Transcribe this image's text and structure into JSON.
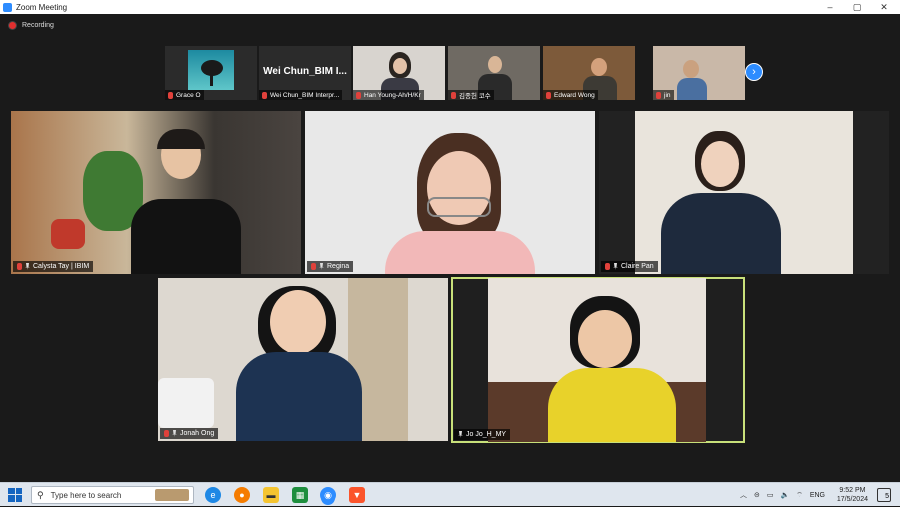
{
  "window": {
    "title": "Zoom Meeting",
    "controls": {
      "minimize": "–",
      "maximize": "▢",
      "close": "✕"
    }
  },
  "recording": {
    "label": "Recording"
  },
  "thumbnails": [
    {
      "name": "Grace O",
      "muted": true
    },
    {
      "name": "Wei Chun_BIM Interpr...",
      "big_label": "Wei Chun_BIM I...",
      "muted": true
    },
    {
      "name": "Han Young-Ah/H/Kr",
      "muted": true
    },
    {
      "name": "김종헌 코수",
      "muted": true
    },
    {
      "name": "Edward Wong",
      "muted": true
    },
    {
      "name": "jin",
      "muted": true
    }
  ],
  "next_page_icon": "chevron-right-icon",
  "gallery": [
    {
      "name": "Calysta Tay | IBIM",
      "muted": true,
      "pinned": true
    },
    {
      "name": "Regina",
      "muted": true,
      "pinned": true
    },
    {
      "name": "Claire Pan",
      "muted": true,
      "pinned": true
    },
    {
      "name": "Jonah Ong",
      "muted": true,
      "pinned": true
    },
    {
      "name": "Jo Jo_H_MY",
      "muted": false,
      "pinned": true,
      "active_speaker": true
    }
  ],
  "taskbar": {
    "search_placeholder": "Type here to search",
    "apps": [
      "edge-icon",
      "firefox-icon",
      "file-explorer-icon",
      "sheets-icon",
      "zoom-icon",
      "brave-icon"
    ],
    "language": "ENG",
    "time": "9:52 PM",
    "date": "17/5/2024",
    "notifications": "5"
  },
  "colors": {
    "accent": "#2d8cff",
    "active_border": "#c8e07a",
    "muted": "#e0413b"
  }
}
